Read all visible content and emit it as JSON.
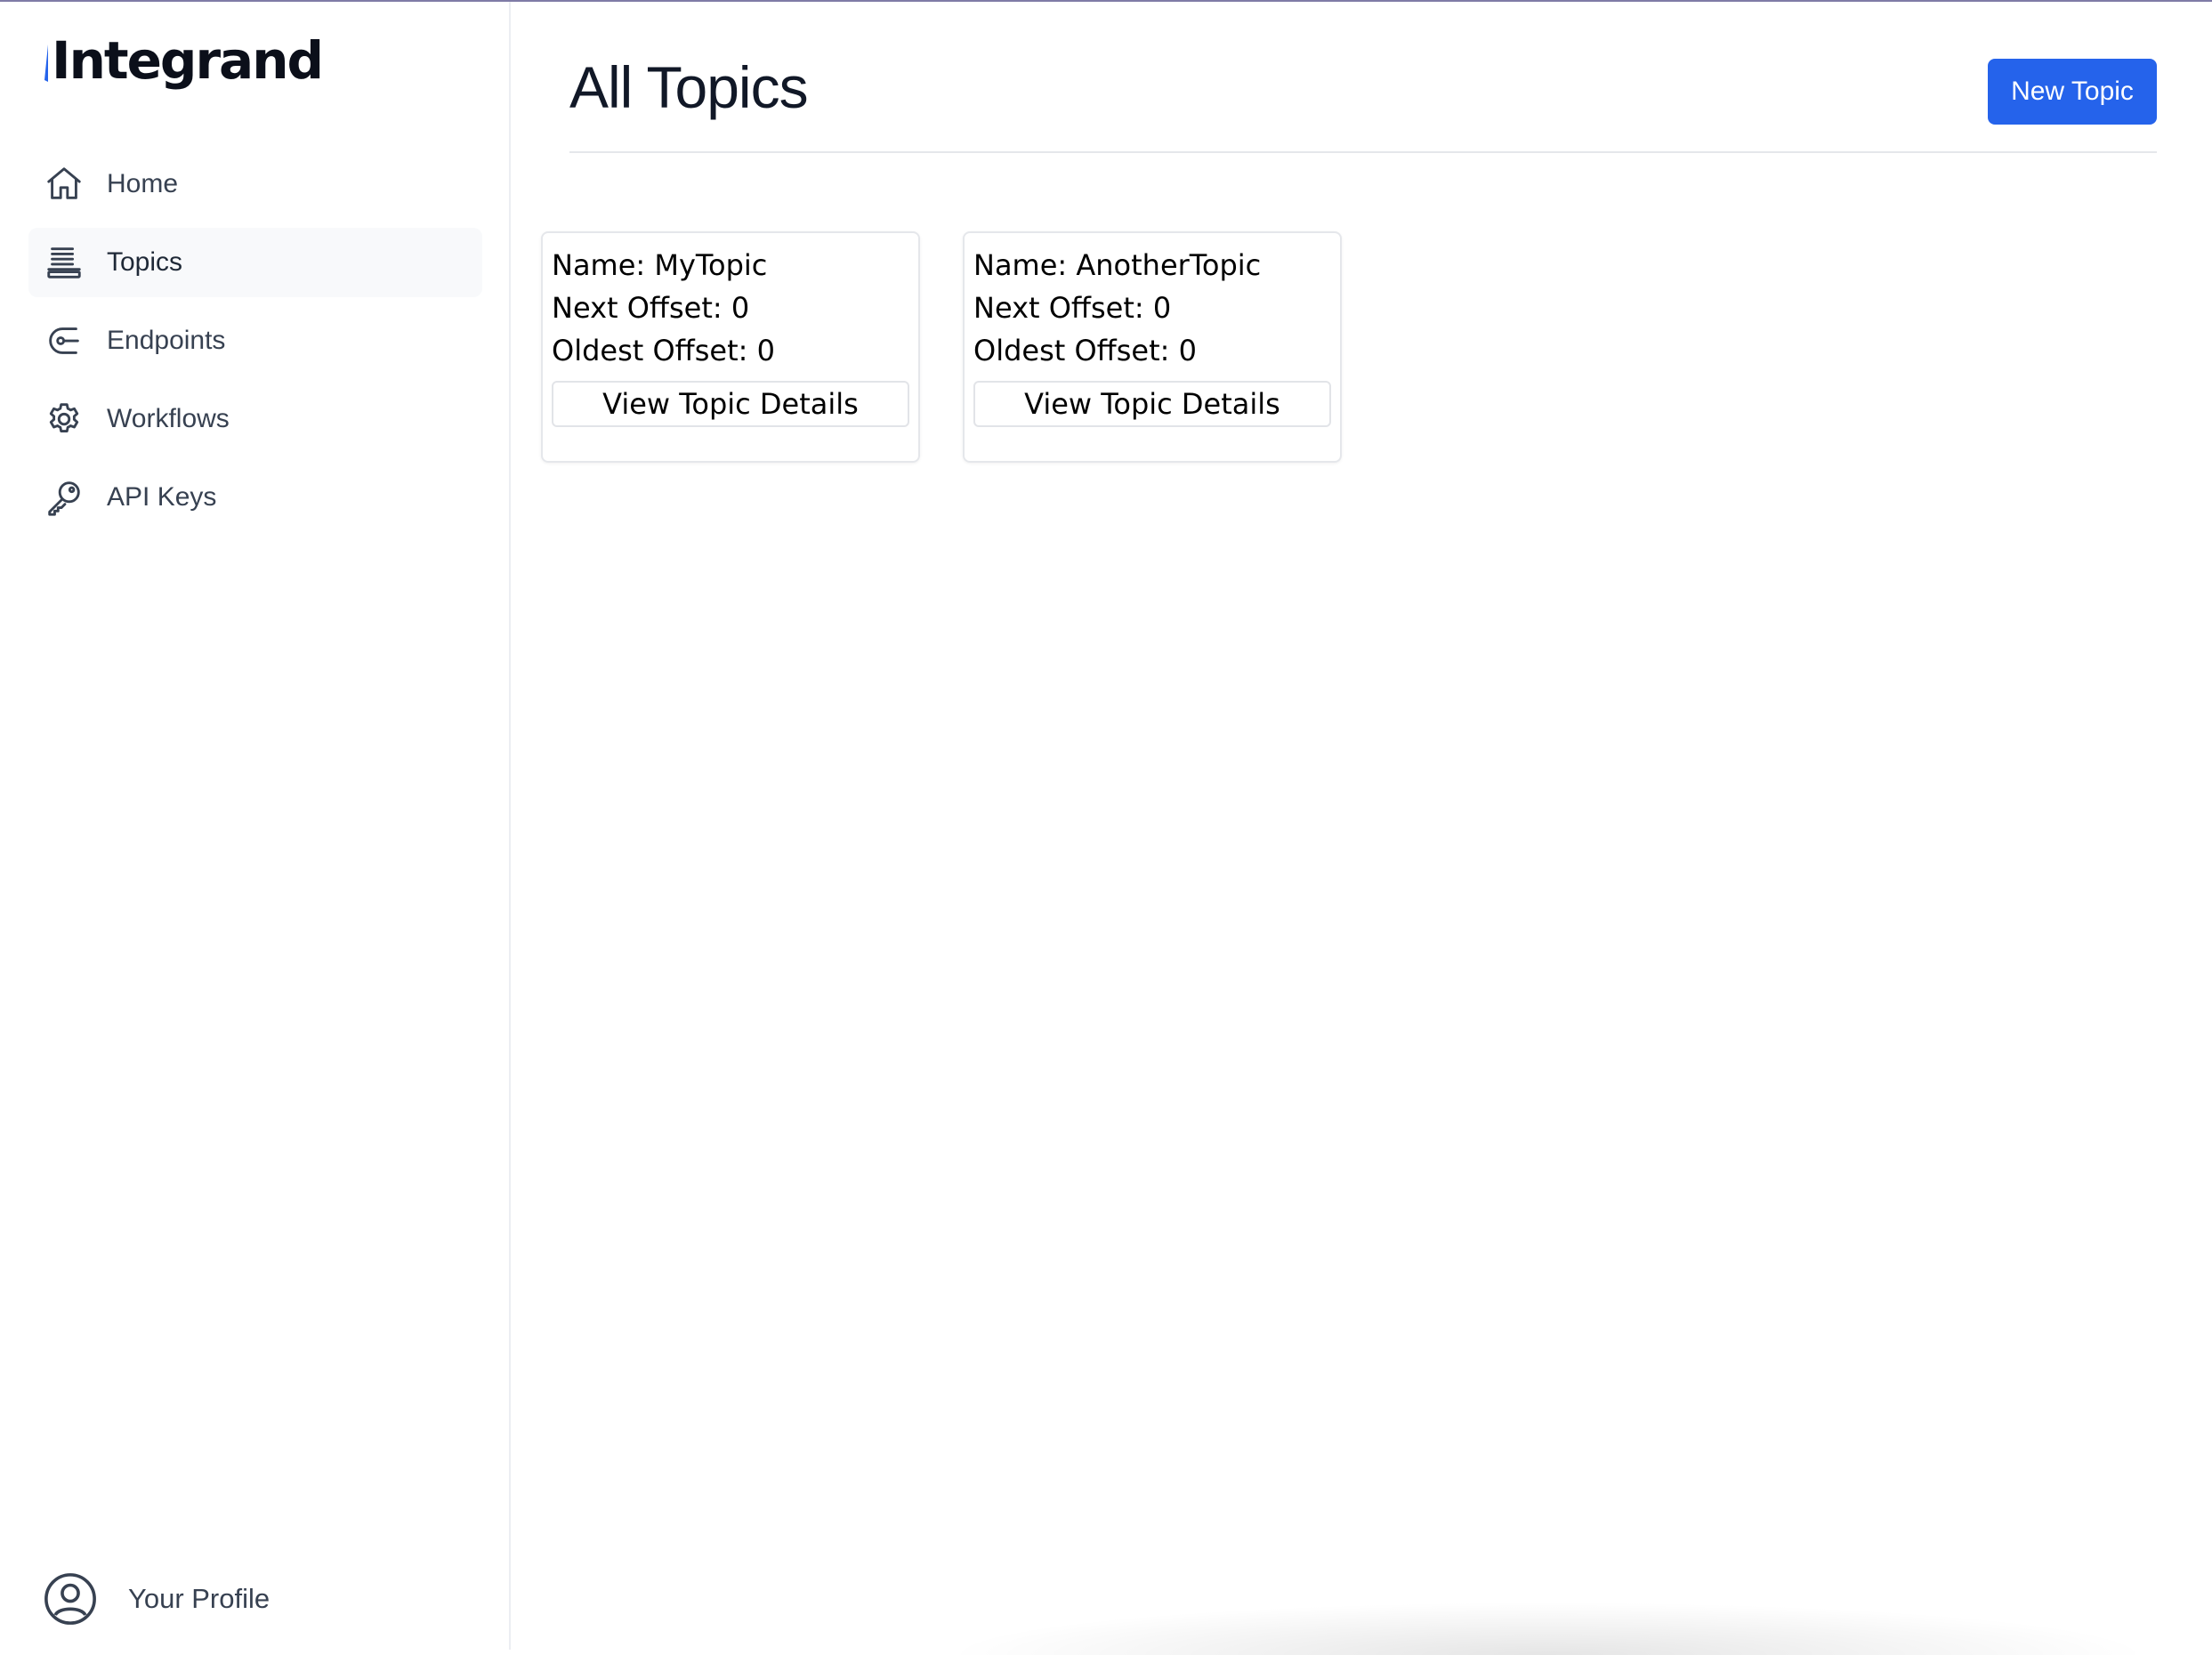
{
  "brand": {
    "name": "Integrand",
    "accent_color": "#2563eb"
  },
  "sidebar": {
    "items": [
      {
        "label": "Home",
        "icon": "home-icon",
        "active": false
      },
      {
        "label": "Topics",
        "icon": "stack-icon",
        "active": true
      },
      {
        "label": "Endpoints",
        "icon": "endpoint-icon",
        "active": false
      },
      {
        "label": "Workflows",
        "icon": "gear-icon",
        "active": false
      },
      {
        "label": "API Keys",
        "icon": "key-icon",
        "active": false
      }
    ],
    "profile_label": "Your Profile"
  },
  "header": {
    "title": "All Topics",
    "new_button_label": "New Topic"
  },
  "topics": [
    {
      "name_line": "Name: MyTopic",
      "next_offset_line": "Next Offset: 0",
      "oldest_offset_line": "Oldest Offset: 0",
      "button_label": "View Topic Details"
    },
    {
      "name_line": "Name: AnotherTopic",
      "next_offset_line": "Next Offset: 0",
      "oldest_offset_line": "Oldest Offset: 0",
      "button_label": "View Topic Details"
    }
  ]
}
